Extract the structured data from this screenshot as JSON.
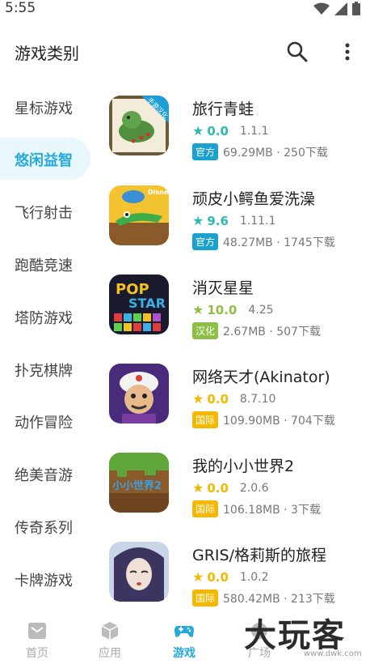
{
  "status_bar": {
    "time": "5:55"
  },
  "header": {
    "title": "游戏类别"
  },
  "colors": {
    "accent": "#25a8dc",
    "star_teal": "#2bb9b1",
    "star_green": "#8dbf45",
    "star_yellow": "#f5b800",
    "tag_guanfang": "#1aa2cf",
    "tag_hanhua": "#8dbf45",
    "tag_guoji": "#f5b800"
  },
  "sidebar": {
    "items": [
      {
        "label": "星标游戏"
      },
      {
        "label": "悠闲益智",
        "active": true
      },
      {
        "label": "飞行射击"
      },
      {
        "label": "跑酷竞速"
      },
      {
        "label": "塔防游戏"
      },
      {
        "label": "扑克棋牌"
      },
      {
        "label": "动作冒险"
      },
      {
        "label": "绝美音游"
      },
      {
        "label": "传奇系列"
      },
      {
        "label": "卡牌游戏"
      }
    ]
  },
  "games": [
    {
      "name": "旅行青蛙",
      "score": "0.0",
      "version": "1.1.1",
      "tag": "官方",
      "size": "69.29MB · 250下载",
      "icon": "frog-icon",
      "icon_badge": "手游汉化"
    },
    {
      "name": "顽皮小鳄鱼爱洗澡",
      "score": "9.6",
      "version": "1.11.1",
      "tag": "官方",
      "size": "48.27MB · 1745下载",
      "icon": "crocodile-icon",
      "icon_badge": "Disney"
    },
    {
      "name": "消灭星星",
      "score": "10.0",
      "version": "4.25",
      "tag": "汉化",
      "size": "2.67MB · 507下载",
      "icon": "popstar-icon",
      "icon_text_1": "POP",
      "icon_text_2": "STAR"
    },
    {
      "name": "网络天才(Akinator)",
      "score": "0.0",
      "version": "8.7.10",
      "tag": "国际",
      "size": "109.90MB · 704下载",
      "icon": "genie-icon"
    },
    {
      "name": "我的小小世界2",
      "score": "0.0",
      "version": "2.0.6",
      "tag": "国际",
      "size": "106.18MB · 3下载",
      "icon": "block-world-icon",
      "icon_text_1": "小小世界2"
    },
    {
      "name": "GRIS/格莉斯的旅程",
      "score": "0.0",
      "version": "1.0.2",
      "tag": "国际",
      "size": "580.42MB · 213下载",
      "icon": "gris-icon"
    }
  ],
  "bottom_nav": {
    "items": [
      {
        "label": "首页",
        "icon": "home-icon"
      },
      {
        "label": "应用",
        "icon": "cube-icon"
      },
      {
        "label": "游戏",
        "icon": "gamepad-icon",
        "active": true
      },
      {
        "label": "广场",
        "icon": "square-icon"
      }
    ]
  },
  "watermark": {
    "text": "大玩客",
    "subtext": "www.dwk.com"
  }
}
